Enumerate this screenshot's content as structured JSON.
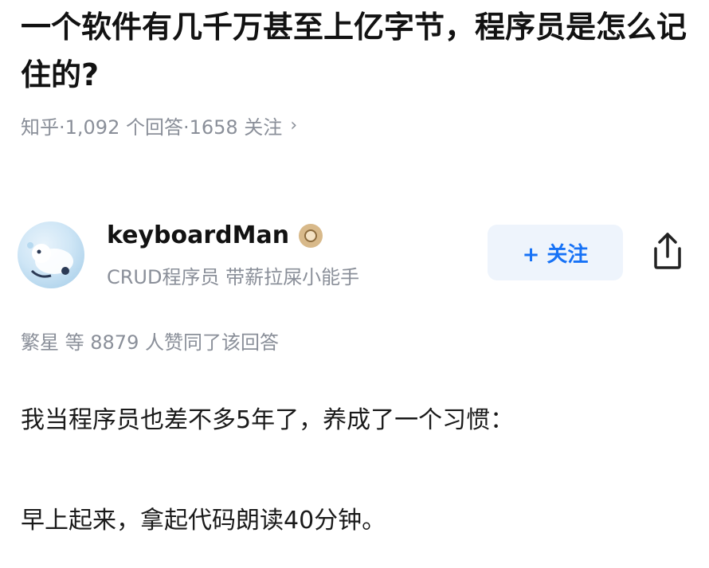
{
  "question": {
    "title": "一个软件有几千万甚至上亿字节，程序员是怎么记住的?",
    "meta": "知乎·1,092 个回答·1658 关注",
    "chevron": "›"
  },
  "author": {
    "name": "keyboardMan",
    "bio": "CRUD程序员 带薪拉屎小能手",
    "follow_label": "+ 关注"
  },
  "answer": {
    "vote_summary": "繁星 等 8879 人赞同了该回答",
    "paragraphs": [
      "我当程序员也差不多5年了，养成了一个习惯：",
      "早上起来，拿起代码朗读40分钟。"
    ]
  },
  "colors": {
    "accent": "#1772f6",
    "follow_bg": "#eef4fc",
    "meta_text": "#8a8f99"
  },
  "icons": [
    "avatar",
    "badge-icon",
    "share-icon"
  ]
}
